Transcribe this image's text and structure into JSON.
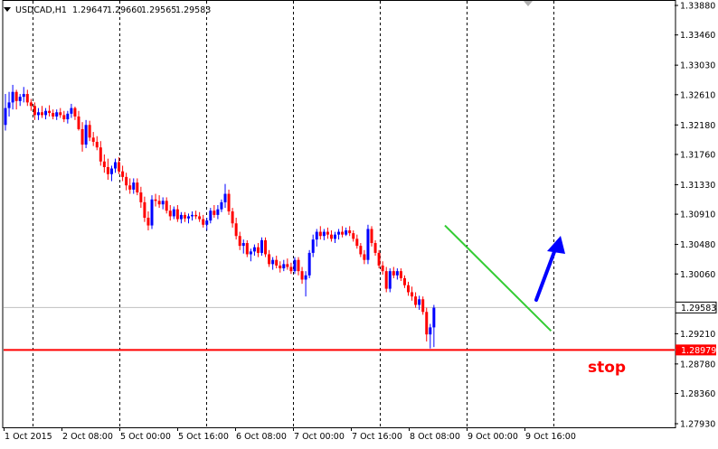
{
  "header": {
    "dropdown_icon": "triangle-down-icon",
    "symbol": "USDCAD,H1",
    "open": "1.29647",
    "high": "1.29660",
    "low": "1.29565",
    "close": "1.29583"
  },
  "price_axis": {
    "ticks": [
      "1.33880",
      "1.33460",
      "1.33030",
      "1.32610",
      "1.32180",
      "1.31760",
      "1.31330",
      "1.30910",
      "1.30480",
      "1.30060",
      "1.29210",
      "1.28780",
      "1.28360",
      "1.27930"
    ],
    "current_price_label": "1.29583",
    "stop_level_label": "1.28979"
  },
  "time_axis": {
    "labels": [
      "1 Oct 2015",
      "2 Oct 08:00",
      "5 Oct 00:00",
      "5 Oct 16:00",
      "6 Oct 08:00",
      "7 Oct 00:00",
      "7 Oct 16:00",
      "8 Oct 08:00",
      "9 Oct 00:00",
      "9 Oct 16:00"
    ]
  },
  "annotations": {
    "stop_label": "stop",
    "arrow_icon": "arrow-up-right-icon",
    "trendline": "descending-trendline"
  },
  "colors": {
    "background": "#ffffff",
    "bull_candle": "#0000ff",
    "bear_candle": "#ff0000",
    "stop_line": "#ff0000",
    "trendline": "#33cc33",
    "arrow": "#0000ff",
    "grid": "#000000",
    "current_price_line": "#c0c0c0"
  },
  "chart_data": {
    "type": "candlestick",
    "symbol": "USDCAD",
    "timeframe": "H1",
    "ylim": [
      1.2779,
      1.3392
    ],
    "horizontal_lines": [
      {
        "name": "stop",
        "value": 1.28979
      },
      {
        "name": "current",
        "value": 1.29583
      }
    ],
    "trendline": {
      "from": {
        "bar": 120,
        "price": 1.3075
      },
      "to": {
        "bar": 148,
        "price": 1.2925
      }
    },
    "candles": [
      [
        1.3218,
        1.3262,
        1.321,
        1.3242
      ],
      [
        1.3242,
        1.3265,
        1.323,
        1.325
      ],
      [
        1.325,
        1.3275,
        1.324,
        1.3265
      ],
      [
        1.3265,
        1.3268,
        1.324,
        1.3252
      ],
      [
        1.3252,
        1.3262,
        1.3245,
        1.3258
      ],
      [
        1.3258,
        1.3272,
        1.325,
        1.3262
      ],
      [
        1.3262,
        1.3268,
        1.3245,
        1.325
      ],
      [
        1.325,
        1.3255,
        1.3238,
        1.3245
      ],
      [
        1.3245,
        1.325,
        1.3225,
        1.3232
      ],
      [
        1.3232,
        1.3242,
        1.3225,
        1.3236
      ],
      [
        1.3236,
        1.3245,
        1.3228,
        1.3232
      ],
      [
        1.3232,
        1.3242,
        1.3226,
        1.3238
      ],
      [
        1.3238,
        1.3246,
        1.323,
        1.3235
      ],
      [
        1.3235,
        1.324,
        1.3226,
        1.323
      ],
      [
        1.323,
        1.324,
        1.3225,
        1.3236
      ],
      [
        1.3236,
        1.3242,
        1.3228,
        1.3232
      ],
      [
        1.3232,
        1.3238,
        1.3222,
        1.3226
      ],
      [
        1.3226,
        1.3238,
        1.322,
        1.3234
      ],
      [
        1.3234,
        1.3248,
        1.3228,
        1.3242
      ],
      [
        1.3242,
        1.3244,
        1.3225,
        1.323
      ],
      [
        1.323,
        1.3238,
        1.321,
        1.3212
      ],
      [
        1.3212,
        1.3222,
        1.318,
        1.319
      ],
      [
        1.319,
        1.3225,
        1.3185,
        1.3218
      ],
      [
        1.3218,
        1.3224,
        1.3195,
        1.32
      ],
      [
        1.32,
        1.3208,
        1.3188,
        1.3194
      ],
      [
        1.3194,
        1.3202,
        1.3182,
        1.3186
      ],
      [
        1.3186,
        1.3195,
        1.316,
        1.3166
      ],
      [
        1.3166,
        1.3176,
        1.315,
        1.3158
      ],
      [
        1.3158,
        1.317,
        1.314,
        1.3148
      ],
      [
        1.3148,
        1.316,
        1.3138,
        1.3156
      ],
      [
        1.3156,
        1.317,
        1.315,
        1.3165
      ],
      [
        1.3165,
        1.3172,
        1.3148,
        1.3152
      ],
      [
        1.3152,
        1.316,
        1.3138,
        1.3144
      ],
      [
        1.3144,
        1.315,
        1.3125,
        1.3132
      ],
      [
        1.3132,
        1.3142,
        1.312,
        1.3126
      ],
      [
        1.3126,
        1.3142,
        1.312,
        1.3136
      ],
      [
        1.3136,
        1.3142,
        1.3118,
        1.3122
      ],
      [
        1.3122,
        1.313,
        1.31,
        1.3108
      ],
      [
        1.3108,
        1.3116,
        1.308,
        1.3086
      ],
      [
        1.3086,
        1.3095,
        1.3068,
        1.3075
      ],
      [
        1.3075,
        1.3118,
        1.307,
        1.3112
      ],
      [
        1.3112,
        1.312,
        1.3102,
        1.311
      ],
      [
        1.311,
        1.3118,
        1.31,
        1.3105
      ],
      [
        1.3105,
        1.3115,
        1.3098,
        1.311
      ],
      [
        1.311,
        1.3115,
        1.3092,
        1.3096
      ],
      [
        1.3096,
        1.3104,
        1.3082,
        1.3088
      ],
      [
        1.3088,
        1.3102,
        1.3084,
        1.3098
      ],
      [
        1.3098,
        1.3104,
        1.308,
        1.3084
      ],
      [
        1.3084,
        1.3094,
        1.3078,
        1.309
      ],
      [
        1.309,
        1.3094,
        1.308,
        1.3085
      ],
      [
        1.3085,
        1.3092,
        1.3078,
        1.3088
      ],
      [
        1.3088,
        1.3095,
        1.3082,
        1.309
      ],
      [
        1.309,
        1.3096,
        1.3084,
        1.3088
      ],
      [
        1.3088,
        1.3094,
        1.308,
        1.3084
      ],
      [
        1.3084,
        1.309,
        1.3072,
        1.3076
      ],
      [
        1.3076,
        1.3086,
        1.3068,
        1.3082
      ],
      [
        1.3082,
        1.31,
        1.3078,
        1.3096
      ],
      [
        1.3096,
        1.3104,
        1.3086,
        1.309
      ],
      [
        1.309,
        1.3104,
        1.3084,
        1.3098
      ],
      [
        1.3098,
        1.3112,
        1.3094,
        1.3108
      ],
      [
        1.3108,
        1.3134,
        1.31,
        1.312
      ],
      [
        1.312,
        1.3126,
        1.309,
        1.3095
      ],
      [
        1.3095,
        1.31,
        1.3072,
        1.3078
      ],
      [
        1.3078,
        1.3086,
        1.3055,
        1.306
      ],
      [
        1.306,
        1.3066,
        1.304,
        1.3046
      ],
      [
        1.3046,
        1.3055,
        1.3035,
        1.305
      ],
      [
        1.305,
        1.3054,
        1.303,
        1.3034
      ],
      [
        1.3034,
        1.3042,
        1.3024,
        1.3038
      ],
      [
        1.3038,
        1.3048,
        1.3032,
        1.3044
      ],
      [
        1.3044,
        1.305,
        1.303,
        1.3036
      ],
      [
        1.3036,
        1.3058,
        1.3032,
        1.3054
      ],
      [
        1.3054,
        1.3058,
        1.303,
        1.3034
      ],
      [
        1.3034,
        1.304,
        1.3016,
        1.302
      ],
      [
        1.302,
        1.303,
        1.3012,
        1.3026
      ],
      [
        1.3026,
        1.3032,
        1.3014,
        1.3018
      ],
      [
        1.3018,
        1.3024,
        1.3008,
        1.3014
      ],
      [
        1.3014,
        1.3026,
        1.301,
        1.302
      ],
      [
        1.302,
        1.3028,
        1.3012,
        1.3016
      ],
      [
        1.3016,
        1.3022,
        1.3006,
        1.301
      ],
      [
        1.301,
        1.303,
        1.3006,
        1.3026
      ],
      [
        1.3026,
        1.303,
        1.3004,
        1.301
      ],
      [
        1.301,
        1.3016,
        1.2992,
        1.2998
      ],
      [
        1.2998,
        1.301,
        1.2974,
        1.3004
      ],
      [
        1.3004,
        1.304,
        1.3,
        1.3036
      ],
      [
        1.3036,
        1.3062,
        1.303,
        1.3055
      ],
      [
        1.3055,
        1.307,
        1.3045,
        1.3066
      ],
      [
        1.3066,
        1.3074,
        1.3055,
        1.306
      ],
      [
        1.306,
        1.307,
        1.3054,
        1.3066
      ],
      [
        1.3066,
        1.3072,
        1.3056,
        1.3062
      ],
      [
        1.3062,
        1.3068,
        1.3052,
        1.3056
      ],
      [
        1.3056,
        1.3066,
        1.305,
        1.3062
      ],
      [
        1.3062,
        1.307,
        1.3055,
        1.3066
      ],
      [
        1.3066,
        1.3074,
        1.3058,
        1.3062
      ],
      [
        1.3062,
        1.3072,
        1.306,
        1.3068
      ],
      [
        1.3068,
        1.3074,
        1.306,
        1.3064
      ],
      [
        1.3064,
        1.3068,
        1.3052,
        1.3056
      ],
      [
        1.3056,
        1.3062,
        1.3042,
        1.3046
      ],
      [
        1.3046,
        1.305,
        1.303,
        1.3034
      ],
      [
        1.3034,
        1.304,
        1.302,
        1.3026
      ],
      [
        1.3026,
        1.3076,
        1.302,
        1.307
      ],
      [
        1.307,
        1.3074,
        1.3045,
        1.305
      ],
      [
        1.305,
        1.3054,
        1.3032,
        1.3036
      ],
      [
        1.3036,
        1.304,
        1.3014,
        1.3018
      ],
      [
        1.3018,
        1.3024,
        1.3005,
        1.301
      ],
      [
        1.301,
        1.3016,
        1.298,
        1.2985
      ],
      [
        1.2985,
        1.3014,
        1.298,
        1.301
      ],
      [
        1.301,
        1.3016,
        1.3,
        1.3004
      ],
      [
        1.3004,
        1.3014,
        1.2998,
        1.301
      ],
      [
        1.301,
        1.3014,
        1.2996,
        1.3
      ],
      [
        1.3,
        1.3004,
        1.2986,
        1.299
      ],
      [
        1.299,
        1.2995,
        1.2975,
        1.298
      ],
      [
        1.298,
        1.2988,
        1.2968,
        1.2974
      ],
      [
        1.2974,
        1.298,
        1.2958,
        1.2962
      ],
      [
        1.2962,
        1.2975,
        1.2955,
        1.297
      ],
      [
        1.297,
        1.2974,
        1.2948,
        1.2952
      ],
      [
        1.2952,
        1.2958,
        1.291,
        1.292
      ],
      [
        1.292,
        1.2935,
        1.29,
        1.293
      ],
      [
        1.293,
        1.2962,
        1.2902,
        1.2958
      ]
    ]
  }
}
